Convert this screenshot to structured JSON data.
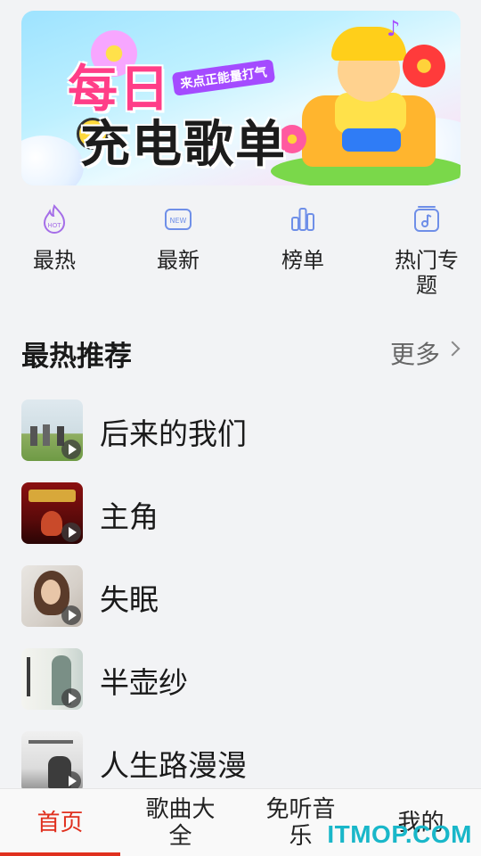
{
  "banner": {
    "title_line1": "每日",
    "title_line2": "充电歌单",
    "subtitle": "来点正能量打气"
  },
  "quick_nav": [
    {
      "label": "最热",
      "icon": "hot-icon",
      "badge": "HOT"
    },
    {
      "label": "最新",
      "icon": "new-icon",
      "badge": "NEW"
    },
    {
      "label": "榜单",
      "icon": "chart-bars-icon"
    },
    {
      "label": "热门专题",
      "icon": "music-album-icon"
    }
  ],
  "section": {
    "title": "最热推荐",
    "more_label": "更多"
  },
  "songs": [
    {
      "title": "后来的我们"
    },
    {
      "title": "主角"
    },
    {
      "title": "失眠"
    },
    {
      "title": "半壶纱"
    },
    {
      "title": "人生路漫漫"
    }
  ],
  "tabs": [
    {
      "label": "首页",
      "active": true
    },
    {
      "label": "歌曲大全"
    },
    {
      "label": "免听音乐"
    },
    {
      "label": "我的"
    }
  ],
  "watermark": "ITMOP.COM",
  "colors": {
    "accent": "#e0301e",
    "icon_blue": "#6f8fe8",
    "icon_purple": "#a56ee8"
  }
}
